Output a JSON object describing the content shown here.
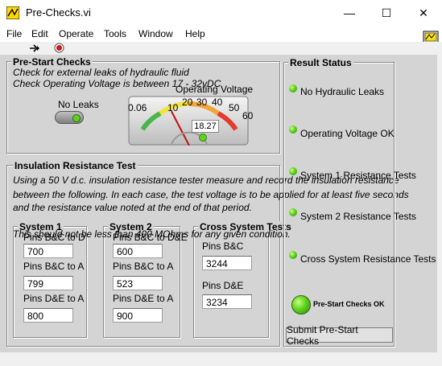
{
  "window": {
    "title": "Pre-Checks.vi",
    "minimize": "—",
    "maximize": "☐",
    "close": "✕"
  },
  "menu": [
    "File",
    "Edit",
    "Operate",
    "Tools",
    "Window",
    "Help"
  ],
  "prestart": {
    "title": "Pre-Start Checks",
    "line1": "Check for external leaks of hydraulic fluid",
    "line2": "Check Operating Voltage is between 17 - 32vDC",
    "noleaks_label": "No Leaks"
  },
  "gauge": {
    "title": "Operating Voltage",
    "ticks": [
      "0.06",
      "10",
      "20",
      "30",
      "40",
      "50",
      "60"
    ],
    "value": 18.27,
    "value_text": "18.27",
    "min": 0,
    "max": 60
  },
  "insulation": {
    "title": "Insulation Resistance Test",
    "line1": "Using a 50 V d.c. insulation resistance tester measure and record the insulation resistance",
    "line2": "between the following. In each case, the test voltage is to be applied for at least five seconds",
    "line3": "and the resistance value noted at the end of that period.",
    "line4": "This should not be less than 400 MOhms for any given condition."
  },
  "system1": {
    "title": "System 1",
    "partial_label": "Pins B&C to D",
    "v1": "700",
    "label2": "Pins B&C to A",
    "v2": "799",
    "label3": "Pins D&E to A",
    "v3": "800"
  },
  "system2": {
    "title": "System 2",
    "partial_label": "Pins B&C to D&E",
    "v1": "600",
    "label2": "Pins B&C to A",
    "v2": "523",
    "label3": "Pins D&E to A",
    "v3": "900"
  },
  "cross": {
    "title": "Cross System Tests",
    "label1": "Pins B&C",
    "v1": "3244",
    "label2": "Pins D&E",
    "v2": "3234"
  },
  "result": {
    "title": "Result Status",
    "items": [
      "No Hydraulic Leaks",
      "Operating Voltage OK",
      "System 1 Resistance Tests",
      "System 2 Resistance Tests",
      "Cross System Resistance Tests"
    ],
    "final": "Pre-Start Checks OK",
    "submit": "Submit Pre-Start Checks"
  },
  "colors": {
    "led_on": "#5fd21f",
    "panel": "#d4d4d4"
  }
}
